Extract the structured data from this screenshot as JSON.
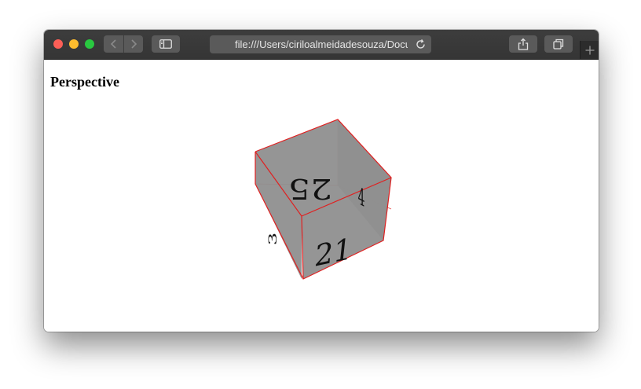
{
  "browser": {
    "url": "file:///Users/ciriloalmeidadesouza/Documents/index.html",
    "url_visible": "file:///Users/ciriloalmeidadesouza/Docu",
    "traffic_lights": {
      "close": "#fc5f57",
      "minimize": "#fdbc2e",
      "zoom": "#29c840"
    },
    "icons": {
      "back": "chevron-left-icon",
      "forward": "chevron-right-icon",
      "sidebar": "sidebar-icon",
      "reload": "reload-icon",
      "share": "share-icon",
      "tabs": "tabs-icon",
      "new_tab": "plus-icon"
    }
  },
  "page": {
    "heading": "Perspective"
  },
  "cube": {
    "face_color": "#8f8f8f",
    "edge_color": "#e02020",
    "face_labels": {
      "top": "25",
      "front": "21",
      "left": "3",
      "right": "4"
    }
  }
}
